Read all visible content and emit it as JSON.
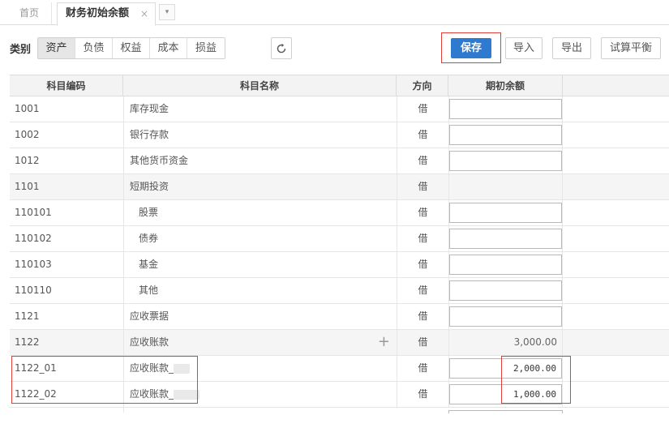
{
  "tabs": {
    "home": "首页",
    "active": "财务初始余额",
    "close": "×",
    "dropdown": "▾"
  },
  "toolbar": {
    "category_label": "类别",
    "categories": [
      "资产",
      "负债",
      "权益",
      "成本",
      "损益"
    ],
    "active_category": "资产",
    "refresh_icon": "refresh-icon",
    "save": "保存",
    "import": "导入",
    "export": "导出",
    "trial_balance": "试算平衡"
  },
  "table": {
    "headers": [
      "科目编码",
      "科目名称",
      "方向",
      "期初余额"
    ],
    "rows": [
      {
        "code": "1001",
        "name": "库存现金",
        "dir": "借",
        "amount": "",
        "input": true
      },
      {
        "code": "1002",
        "name": "银行存款",
        "dir": "借",
        "amount": "",
        "input": true
      },
      {
        "code": "1012",
        "name": "其他货币资金",
        "dir": "借",
        "amount": "",
        "input": true
      },
      {
        "code": "1101",
        "name": "短期投资",
        "dir": "借",
        "amount": "",
        "input": false
      },
      {
        "code": "110101",
        "name": "股票",
        "dir": "借",
        "amount": "",
        "input": true
      },
      {
        "code": "110102",
        "name": "债券",
        "dir": "借",
        "amount": "",
        "input": true
      },
      {
        "code": "110103",
        "name": "基金",
        "dir": "借",
        "amount": "",
        "input": true
      },
      {
        "code": "110110",
        "name": "其他",
        "dir": "借",
        "amount": "",
        "input": true
      },
      {
        "code": "1121",
        "name": "应收票据",
        "dir": "借",
        "amount": "",
        "input": true
      },
      {
        "code": "1122",
        "name": "应收账款",
        "dir": "借",
        "amount": "3,000.00",
        "input": false
      },
      {
        "code": "1122_01",
        "name": "应收账款_",
        "dir": "借",
        "amount": "2,000.00",
        "input": true
      },
      {
        "code": "1122_02",
        "name": "应收账款_",
        "dir": "借",
        "amount": "1,000.00",
        "input": true
      }
    ]
  },
  "colors": {
    "accent": "#2e7ad1",
    "highlight": "#e0403a"
  }
}
